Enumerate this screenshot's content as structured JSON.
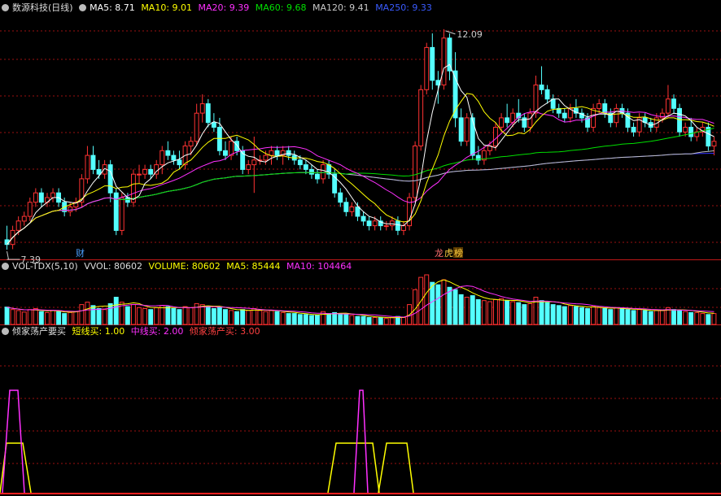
{
  "colors": {
    "bg": "#000000",
    "up": "#ff3232",
    "down": "#54ffff",
    "grid": "#9b1010",
    "ma5": "#ffffff",
    "ma10": "#ffff00",
    "ma20": "#ff30ff",
    "ma60": "#00e000",
    "ma120": "#c0c0c0",
    "ma250": "#3030ff"
  },
  "header_main": {
    "title": "数源科技(日线)",
    "ma5": "MA5: 8.71",
    "ma10": "MA10: 9.01",
    "ma20": "MA20: 9.39",
    "ma60": "MA60: 9.68",
    "ma120": "MA120: 9.41",
    "ma250": "MA250: 9.33"
  },
  "header_vol": {
    "title": "VOL-TDX(5,10)",
    "vvol": "VVOL: 80602",
    "volume": "VOLUME: 80602",
    "ma5": "MA5: 85444",
    "ma10": "MA10: 104464"
  },
  "header_ind": {
    "title": "倾家荡产要买",
    "short": "短线买: 1.00",
    "mid": "中线买: 2.00",
    "all": "倾家荡产买: 3.00"
  },
  "labels": {
    "high_mark": "12.09",
    "low_mark": "7.39",
    "tag_cai": "财",
    "tag_dragon1": "龙",
    "tag_dragon2": "虎",
    "tag_bang": "榜"
  },
  "chart_data": {
    "type": "candlestick",
    "ohlc": [
      [
        7.6,
        7.9,
        7.39,
        7.5
      ],
      [
        7.5,
        7.9,
        7.4,
        7.8
      ],
      [
        7.8,
        8.1,
        7.7,
        8.0
      ],
      [
        8.0,
        8.2,
        7.9,
        8.1
      ],
      [
        8.1,
        8.5,
        8.0,
        8.4
      ],
      [
        8.4,
        8.7,
        8.3,
        8.6
      ],
      [
        8.6,
        8.7,
        8.3,
        8.4
      ],
      [
        8.4,
        8.6,
        8.3,
        8.5
      ],
      [
        8.5,
        8.7,
        8.4,
        8.6
      ],
      [
        8.6,
        8.7,
        8.3,
        8.4
      ],
      [
        8.4,
        8.5,
        8.1,
        8.2
      ],
      [
        8.2,
        8.4,
        8.1,
        8.3
      ],
      [
        8.3,
        8.5,
        8.2,
        8.4
      ],
      [
        8.4,
        9.0,
        8.3,
        8.9
      ],
      [
        8.9,
        9.6,
        8.8,
        9.4
      ],
      [
        9.4,
        9.6,
        9.0,
        9.1
      ],
      [
        9.1,
        9.3,
        8.9,
        9.0
      ],
      [
        9.0,
        9.3,
        8.9,
        9.2
      ],
      [
        9.2,
        9.3,
        8.4,
        8.6
      ],
      [
        8.6,
        8.7,
        7.7,
        7.8
      ],
      [
        7.8,
        8.6,
        7.7,
        8.5
      ],
      [
        8.5,
        8.6,
        8.3,
        8.4
      ],
      [
        8.4,
        9.1,
        8.3,
        9.0
      ],
      [
        9.0,
        9.2,
        8.8,
        9.0
      ],
      [
        9.0,
        9.2,
        8.9,
        9.1
      ],
      [
        9.1,
        9.2,
        8.9,
        9.0
      ],
      [
        9.0,
        9.3,
        8.9,
        9.2
      ],
      [
        9.2,
        9.6,
        9.0,
        9.5
      ],
      [
        9.5,
        9.7,
        9.3,
        9.4
      ],
      [
        9.4,
        9.5,
        9.2,
        9.3
      ],
      [
        9.3,
        9.5,
        9.1,
        9.2
      ],
      [
        9.2,
        9.7,
        9.1,
        9.6
      ],
      [
        9.6,
        9.8,
        9.4,
        9.7
      ],
      [
        9.7,
        10.5,
        9.6,
        10.3
      ],
      [
        10.3,
        10.7,
        10.1,
        10.5
      ],
      [
        10.5,
        10.6,
        10.0,
        10.1
      ],
      [
        10.1,
        10.3,
        9.9,
        10.0
      ],
      [
        10.0,
        10.2,
        9.4,
        9.5
      ],
      [
        9.5,
        9.7,
        9.3,
        9.4
      ],
      [
        9.4,
        9.8,
        9.3,
        9.7
      ],
      [
        9.7,
        9.8,
        9.4,
        9.5
      ],
      [
        9.5,
        9.6,
        9.0,
        9.1
      ],
      [
        9.1,
        9.3,
        9.0,
        9.2
      ],
      [
        9.2,
        9.8,
        8.6,
        9.3
      ],
      [
        9.3,
        9.4,
        9.2,
        9.3
      ],
      [
        9.3,
        9.5,
        9.2,
        9.4
      ],
      [
        9.4,
        9.6,
        9.2,
        9.5
      ],
      [
        9.5,
        9.6,
        9.3,
        9.4
      ],
      [
        9.4,
        9.6,
        9.2,
        9.5
      ],
      [
        9.5,
        9.6,
        9.3,
        9.4
      ],
      [
        9.4,
        9.5,
        9.2,
        9.3
      ],
      [
        9.3,
        9.4,
        9.1,
        9.2
      ],
      [
        9.2,
        9.3,
        9.0,
        9.1
      ],
      [
        9.1,
        9.2,
        8.9,
        9.0
      ],
      [
        9.0,
        9.1,
        8.8,
        8.9
      ],
      [
        8.9,
        9.3,
        8.8,
        9.2
      ],
      [
        9.2,
        9.3,
        8.9,
        9.0
      ],
      [
        9.0,
        9.1,
        8.5,
        8.6
      ],
      [
        8.6,
        8.7,
        8.3,
        8.4
      ],
      [
        8.4,
        8.5,
        8.1,
        8.2
      ],
      [
        8.2,
        8.4,
        8.1,
        8.3
      ],
      [
        8.3,
        8.4,
        8.0,
        8.1
      ],
      [
        8.1,
        8.2,
        7.9,
        8.0
      ],
      [
        8.0,
        8.1,
        7.8,
        7.9
      ],
      [
        7.9,
        8.1,
        7.8,
        8.0
      ],
      [
        8.0,
        8.1,
        7.8,
        7.9
      ],
      [
        7.9,
        8.0,
        7.8,
        7.9
      ],
      [
        7.9,
        8.1,
        7.8,
        8.0
      ],
      [
        8.0,
        8.1,
        7.7,
        7.8
      ],
      [
        7.8,
        8.0,
        7.7,
        7.9
      ],
      [
        7.9,
        8.6,
        7.8,
        8.5
      ],
      [
        8.5,
        9.7,
        8.4,
        9.6
      ],
      [
        9.6,
        10.9,
        9.5,
        10.8
      ],
      [
        10.8,
        11.8,
        10.7,
        11.7
      ],
      [
        11.7,
        12.0,
        10.8,
        11.0
      ],
      [
        11.0,
        11.2,
        10.5,
        10.9
      ],
      [
        10.9,
        12.09,
        10.8,
        11.9
      ],
      [
        11.9,
        12.0,
        11.0,
        11.2
      ],
      [
        11.2,
        11.6,
        10.0,
        10.2
      ],
      [
        10.2,
        10.4,
        9.6,
        9.7
      ],
      [
        9.7,
        10.3,
        9.6,
        10.2
      ],
      [
        10.2,
        10.3,
        9.3,
        9.4
      ],
      [
        9.4,
        9.6,
        9.2,
        9.3
      ],
      [
        9.3,
        9.6,
        9.2,
        9.5
      ],
      [
        9.5,
        9.7,
        9.4,
        9.6
      ],
      [
        9.6,
        10.1,
        9.5,
        10.0
      ],
      [
        10.0,
        10.3,
        9.9,
        10.2
      ],
      [
        10.2,
        10.5,
        10.0,
        10.1
      ],
      [
        10.1,
        10.4,
        10.0,
        10.3
      ],
      [
        10.3,
        10.6,
        10.1,
        10.2
      ],
      [
        10.2,
        10.3,
        9.9,
        10.0
      ],
      [
        10.0,
        10.4,
        9.9,
        10.3
      ],
      [
        10.3,
        11.1,
        10.2,
        10.9
      ],
      [
        10.9,
        11.3,
        10.7,
        10.8
      ],
      [
        10.8,
        10.9,
        10.5,
        10.6
      ],
      [
        10.6,
        10.7,
        10.3,
        10.4
      ],
      [
        10.4,
        10.5,
        10.2,
        10.3
      ],
      [
        10.3,
        10.4,
        10.1,
        10.2
      ],
      [
        10.2,
        10.5,
        10.1,
        10.4
      ],
      [
        10.4,
        10.6,
        10.2,
        10.3
      ],
      [
        10.3,
        10.4,
        10.1,
        10.2
      ],
      [
        10.2,
        10.3,
        9.9,
        10.0
      ],
      [
        10.0,
        10.5,
        9.9,
        10.4
      ],
      [
        10.4,
        10.6,
        10.3,
        10.5
      ],
      [
        10.5,
        10.6,
        10.2,
        10.3
      ],
      [
        10.3,
        10.4,
        10.0,
        10.1
      ],
      [
        10.1,
        10.5,
        10.0,
        10.4
      ],
      [
        10.4,
        10.5,
        10.2,
        10.3
      ],
      [
        10.3,
        10.4,
        9.9,
        10.0
      ],
      [
        10.0,
        10.1,
        9.8,
        9.9
      ],
      [
        9.9,
        10.3,
        9.8,
        10.2
      ],
      [
        10.2,
        10.3,
        10.0,
        10.1
      ],
      [
        10.1,
        10.2,
        9.9,
        10.0
      ],
      [
        10.0,
        10.3,
        9.9,
        10.2
      ],
      [
        10.2,
        10.4,
        10.1,
        10.3
      ],
      [
        10.3,
        10.9,
        10.2,
        10.6
      ],
      [
        10.6,
        10.7,
        10.3,
        10.4
      ],
      [
        10.4,
        10.5,
        9.8,
        9.9
      ],
      [
        9.9,
        10.1,
        9.8,
        10.0
      ],
      [
        10.0,
        10.2,
        9.7,
        9.8
      ],
      [
        9.8,
        10.0,
        9.7,
        9.9
      ],
      [
        9.9,
        10.1,
        9.8,
        10.0
      ],
      [
        10.0,
        10.1,
        9.5,
        9.6
      ],
      [
        9.6,
        9.8,
        9.4,
        9.7
      ]
    ],
    "volume": [
      35,
      30,
      28,
      25,
      30,
      32,
      26,
      24,
      28,
      26,
      22,
      24,
      26,
      40,
      45,
      38,
      32,
      30,
      42,
      55,
      45,
      36,
      40,
      34,
      32,
      30,
      34,
      38,
      36,
      32,
      30,
      36,
      34,
      42,
      40,
      36,
      32,
      34,
      30,
      28,
      26,
      30,
      28,
      32,
      28,
      26,
      28,
      26,
      24,
      22,
      22,
      20,
      20,
      18,
      18,
      26,
      22,
      24,
      22,
      20,
      18,
      16,
      16,
      14,
      14,
      14,
      12,
      14,
      16,
      14,
      40,
      70,
      95,
      100,
      85,
      80,
      90,
      75,
      70,
      60,
      55,
      58,
      50,
      48,
      46,
      50,
      52,
      48,
      46,
      44,
      40,
      42,
      55,
      48,
      44,
      40,
      38,
      36,
      38,
      36,
      34,
      32,
      36,
      34,
      32,
      30,
      34,
      32,
      30,
      28,
      30,
      28,
      26,
      28,
      28,
      34,
      30,
      28,
      26,
      24,
      24,
      22,
      20,
      22
    ],
    "indicator": {
      "short_buy": "1.00",
      "mid_buy": "2.00",
      "all_in_buy": "3.00"
    },
    "price_high": 12.09,
    "price_low": 7.39
  }
}
